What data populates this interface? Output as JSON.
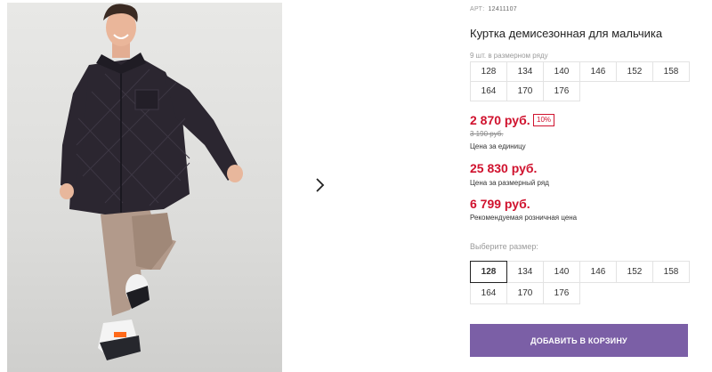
{
  "product": {
    "art_label": "АРТ:",
    "art_number": "12411107",
    "title": "Куртка демисезонная для мальчика"
  },
  "size_info": {
    "label": "9 шт. в размерном ряду",
    "sizes": [
      "128",
      "134",
      "140",
      "146",
      "152",
      "158",
      "164",
      "170",
      "176"
    ]
  },
  "pricing": {
    "unit_price": "2 870 руб.",
    "discount": "10%",
    "old_price": "3 190 руб.",
    "unit_caption": "Цена за единицу",
    "row_price": "25 830 руб.",
    "row_caption": "Цена за размерный ряд",
    "retail_price": "6 799 руб.",
    "retail_caption": "Рекомендуемая розничная цена"
  },
  "size_select": {
    "label": "Выберите размер:",
    "selected": "128",
    "sizes": [
      "128",
      "134",
      "140",
      "146",
      "152",
      "158",
      "164",
      "170",
      "176"
    ]
  },
  "cart": {
    "button_label": "ДОБАВИТЬ В КОРЗИНУ"
  },
  "colors": {
    "accent_price": "#d0122e",
    "cart_button": "#7b5fa6"
  },
  "icons": {
    "next": "chevron-right-icon"
  }
}
